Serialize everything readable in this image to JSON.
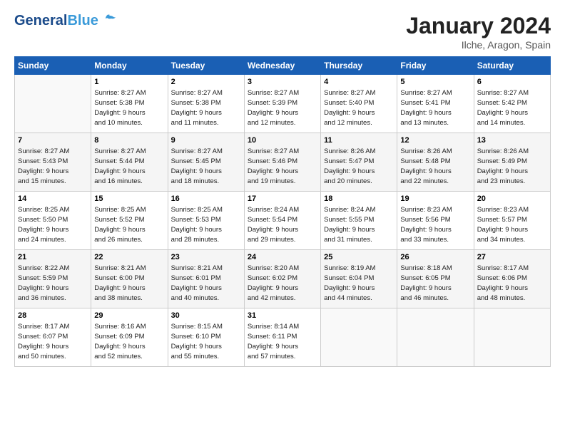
{
  "header": {
    "logo_line1": "General",
    "logo_line2": "Blue",
    "month_title": "January 2024",
    "location": "Ilche, Aragon, Spain"
  },
  "weekdays": [
    "Sunday",
    "Monday",
    "Tuesday",
    "Wednesday",
    "Thursday",
    "Friday",
    "Saturday"
  ],
  "weeks": [
    [
      {
        "day": "",
        "info": ""
      },
      {
        "day": "1",
        "info": "Sunrise: 8:27 AM\nSunset: 5:38 PM\nDaylight: 9 hours\nand 10 minutes."
      },
      {
        "day": "2",
        "info": "Sunrise: 8:27 AM\nSunset: 5:38 PM\nDaylight: 9 hours\nand 11 minutes."
      },
      {
        "day": "3",
        "info": "Sunrise: 8:27 AM\nSunset: 5:39 PM\nDaylight: 9 hours\nand 12 minutes."
      },
      {
        "day": "4",
        "info": "Sunrise: 8:27 AM\nSunset: 5:40 PM\nDaylight: 9 hours\nand 12 minutes."
      },
      {
        "day": "5",
        "info": "Sunrise: 8:27 AM\nSunset: 5:41 PM\nDaylight: 9 hours\nand 13 minutes."
      },
      {
        "day": "6",
        "info": "Sunrise: 8:27 AM\nSunset: 5:42 PM\nDaylight: 9 hours\nand 14 minutes."
      }
    ],
    [
      {
        "day": "7",
        "info": "Sunrise: 8:27 AM\nSunset: 5:43 PM\nDaylight: 9 hours\nand 15 minutes."
      },
      {
        "day": "8",
        "info": "Sunrise: 8:27 AM\nSunset: 5:44 PM\nDaylight: 9 hours\nand 16 minutes."
      },
      {
        "day": "9",
        "info": "Sunrise: 8:27 AM\nSunset: 5:45 PM\nDaylight: 9 hours\nand 18 minutes."
      },
      {
        "day": "10",
        "info": "Sunrise: 8:27 AM\nSunset: 5:46 PM\nDaylight: 9 hours\nand 19 minutes."
      },
      {
        "day": "11",
        "info": "Sunrise: 8:26 AM\nSunset: 5:47 PM\nDaylight: 9 hours\nand 20 minutes."
      },
      {
        "day": "12",
        "info": "Sunrise: 8:26 AM\nSunset: 5:48 PM\nDaylight: 9 hours\nand 22 minutes."
      },
      {
        "day": "13",
        "info": "Sunrise: 8:26 AM\nSunset: 5:49 PM\nDaylight: 9 hours\nand 23 minutes."
      }
    ],
    [
      {
        "day": "14",
        "info": "Sunrise: 8:25 AM\nSunset: 5:50 PM\nDaylight: 9 hours\nand 24 minutes."
      },
      {
        "day": "15",
        "info": "Sunrise: 8:25 AM\nSunset: 5:52 PM\nDaylight: 9 hours\nand 26 minutes."
      },
      {
        "day": "16",
        "info": "Sunrise: 8:25 AM\nSunset: 5:53 PM\nDaylight: 9 hours\nand 28 minutes."
      },
      {
        "day": "17",
        "info": "Sunrise: 8:24 AM\nSunset: 5:54 PM\nDaylight: 9 hours\nand 29 minutes."
      },
      {
        "day": "18",
        "info": "Sunrise: 8:24 AM\nSunset: 5:55 PM\nDaylight: 9 hours\nand 31 minutes."
      },
      {
        "day": "19",
        "info": "Sunrise: 8:23 AM\nSunset: 5:56 PM\nDaylight: 9 hours\nand 33 minutes."
      },
      {
        "day": "20",
        "info": "Sunrise: 8:23 AM\nSunset: 5:57 PM\nDaylight: 9 hours\nand 34 minutes."
      }
    ],
    [
      {
        "day": "21",
        "info": "Sunrise: 8:22 AM\nSunset: 5:59 PM\nDaylight: 9 hours\nand 36 minutes."
      },
      {
        "day": "22",
        "info": "Sunrise: 8:21 AM\nSunset: 6:00 PM\nDaylight: 9 hours\nand 38 minutes."
      },
      {
        "day": "23",
        "info": "Sunrise: 8:21 AM\nSunset: 6:01 PM\nDaylight: 9 hours\nand 40 minutes."
      },
      {
        "day": "24",
        "info": "Sunrise: 8:20 AM\nSunset: 6:02 PM\nDaylight: 9 hours\nand 42 minutes."
      },
      {
        "day": "25",
        "info": "Sunrise: 8:19 AM\nSunset: 6:04 PM\nDaylight: 9 hours\nand 44 minutes."
      },
      {
        "day": "26",
        "info": "Sunrise: 8:18 AM\nSunset: 6:05 PM\nDaylight: 9 hours\nand 46 minutes."
      },
      {
        "day": "27",
        "info": "Sunrise: 8:17 AM\nSunset: 6:06 PM\nDaylight: 9 hours\nand 48 minutes."
      }
    ],
    [
      {
        "day": "28",
        "info": "Sunrise: 8:17 AM\nSunset: 6:07 PM\nDaylight: 9 hours\nand 50 minutes."
      },
      {
        "day": "29",
        "info": "Sunrise: 8:16 AM\nSunset: 6:09 PM\nDaylight: 9 hours\nand 52 minutes."
      },
      {
        "day": "30",
        "info": "Sunrise: 8:15 AM\nSunset: 6:10 PM\nDaylight: 9 hours\nand 55 minutes."
      },
      {
        "day": "31",
        "info": "Sunrise: 8:14 AM\nSunset: 6:11 PM\nDaylight: 9 hours\nand 57 minutes."
      },
      {
        "day": "",
        "info": ""
      },
      {
        "day": "",
        "info": ""
      },
      {
        "day": "",
        "info": ""
      }
    ]
  ]
}
